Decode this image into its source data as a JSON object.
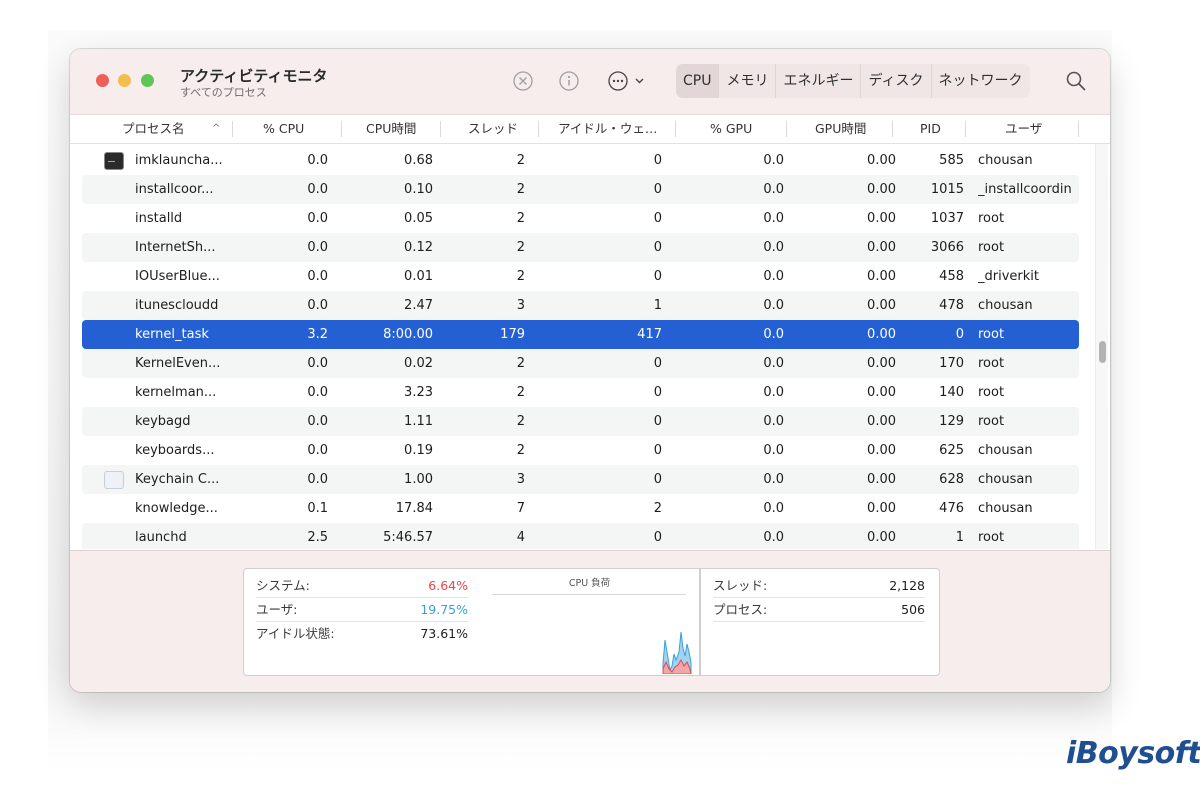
{
  "window": {
    "title": "アクティビティモニタ",
    "subtitle": "すべてのプロセス"
  },
  "toolbar": {
    "icons": [
      "stop-process-icon",
      "info-icon",
      "more-actions-icon"
    ],
    "tabs": [
      {
        "label": "CPU",
        "active": true
      },
      {
        "label": "メモリ",
        "active": false
      },
      {
        "label": "エネルギー",
        "active": false
      },
      {
        "label": "ディスク",
        "active": false
      },
      {
        "label": "ネットワーク",
        "active": false
      }
    ]
  },
  "columns": {
    "name": "プロセス名",
    "cpu": "% CPU",
    "cpu_time": "CPU時間",
    "threads": "スレッド",
    "idle_wake": "アイドル・ウェ…",
    "gpu": "% GPU",
    "gpu_time": "GPU時間",
    "pid": "PID",
    "user": "ユーザ"
  },
  "processes": [
    {
      "name": "imklauncha...",
      "cpu": "0.0",
      "cpu_time": "0.68",
      "threads": "2",
      "idle_wake": "0",
      "gpu": "0.0",
      "gpu_time": "0.00",
      "pid": "585",
      "user": "chousan",
      "icon": "terminal-icon"
    },
    {
      "name": "installcoor...",
      "cpu": "0.0",
      "cpu_time": "0.10",
      "threads": "2",
      "idle_wake": "0",
      "gpu": "0.0",
      "gpu_time": "0.00",
      "pid": "1015",
      "user": "_installcoordin"
    },
    {
      "name": "installd",
      "cpu": "0.0",
      "cpu_time": "0.05",
      "threads": "2",
      "idle_wake": "0",
      "gpu": "0.0",
      "gpu_time": "0.00",
      "pid": "1037",
      "user": "root"
    },
    {
      "name": "InternetSh...",
      "cpu": "0.0",
      "cpu_time": "0.12",
      "threads": "2",
      "idle_wake": "0",
      "gpu": "0.0",
      "gpu_time": "0.00",
      "pid": "3066",
      "user": "root"
    },
    {
      "name": "IOUserBlue...",
      "cpu": "0.0",
      "cpu_time": "0.01",
      "threads": "2",
      "idle_wake": "0",
      "gpu": "0.0",
      "gpu_time": "0.00",
      "pid": "458",
      "user": "_driverkit"
    },
    {
      "name": "itunescloudd",
      "cpu": "0.0",
      "cpu_time": "2.47",
      "threads": "3",
      "idle_wake": "1",
      "gpu": "0.0",
      "gpu_time": "0.00",
      "pid": "478",
      "user": "chousan"
    },
    {
      "name": "kernel_task",
      "cpu": "3.2",
      "cpu_time": "8:00.00",
      "threads": "179",
      "idle_wake": "417",
      "gpu": "0.0",
      "gpu_time": "0.00",
      "pid": "0",
      "user": "root",
      "selected": true
    },
    {
      "name": "KernelEven...",
      "cpu": "0.0",
      "cpu_time": "0.02",
      "threads": "2",
      "idle_wake": "0",
      "gpu": "0.0",
      "gpu_time": "0.00",
      "pid": "170",
      "user": "root"
    },
    {
      "name": "kernelman...",
      "cpu": "0.0",
      "cpu_time": "3.23",
      "threads": "2",
      "idle_wake": "0",
      "gpu": "0.0",
      "gpu_time": "0.00",
      "pid": "140",
      "user": "root"
    },
    {
      "name": "keybagd",
      "cpu": "0.0",
      "cpu_time": "1.11",
      "threads": "2",
      "idle_wake": "0",
      "gpu": "0.0",
      "gpu_time": "0.00",
      "pid": "129",
      "user": "root"
    },
    {
      "name": "keyboards...",
      "cpu": "0.0",
      "cpu_time": "0.19",
      "threads": "2",
      "idle_wake": "0",
      "gpu": "0.0",
      "gpu_time": "0.00",
      "pid": "625",
      "user": "chousan"
    },
    {
      "name": "Keychain C...",
      "cpu": "0.0",
      "cpu_time": "1.00",
      "threads": "3",
      "idle_wake": "0",
      "gpu": "0.0",
      "gpu_time": "0.00",
      "pid": "628",
      "user": "chousan",
      "icon": "keychain-icon"
    },
    {
      "name": "knowledge...",
      "cpu": "0.1",
      "cpu_time": "17.84",
      "threads": "7",
      "idle_wake": "2",
      "gpu": "0.0",
      "gpu_time": "0.00",
      "pid": "476",
      "user": "chousan"
    },
    {
      "name": "launchd",
      "cpu": "2.5",
      "cpu_time": "5:46.57",
      "threads": "4",
      "idle_wake": "0",
      "gpu": "0.0",
      "gpu_time": "0.00",
      "pid": "1",
      "user": "root"
    }
  ],
  "summary": {
    "system_label": "システム:",
    "system_value": "6.64%",
    "user_label": "ユーザ:",
    "user_value": "19.75%",
    "idle_label": "アイドル状態:",
    "idle_value": "73.61%",
    "chart_title": "CPU 負荷",
    "threads_label": "スレッド:",
    "threads_value": "2,128",
    "processes_label": "プロセス:",
    "processes_value": "506"
  },
  "colors": {
    "system": "#e5484d",
    "user": "#3aa0d8",
    "selection": "#2460d3",
    "toolbar": "#f8eded"
  },
  "watermark": "iBoysoft"
}
